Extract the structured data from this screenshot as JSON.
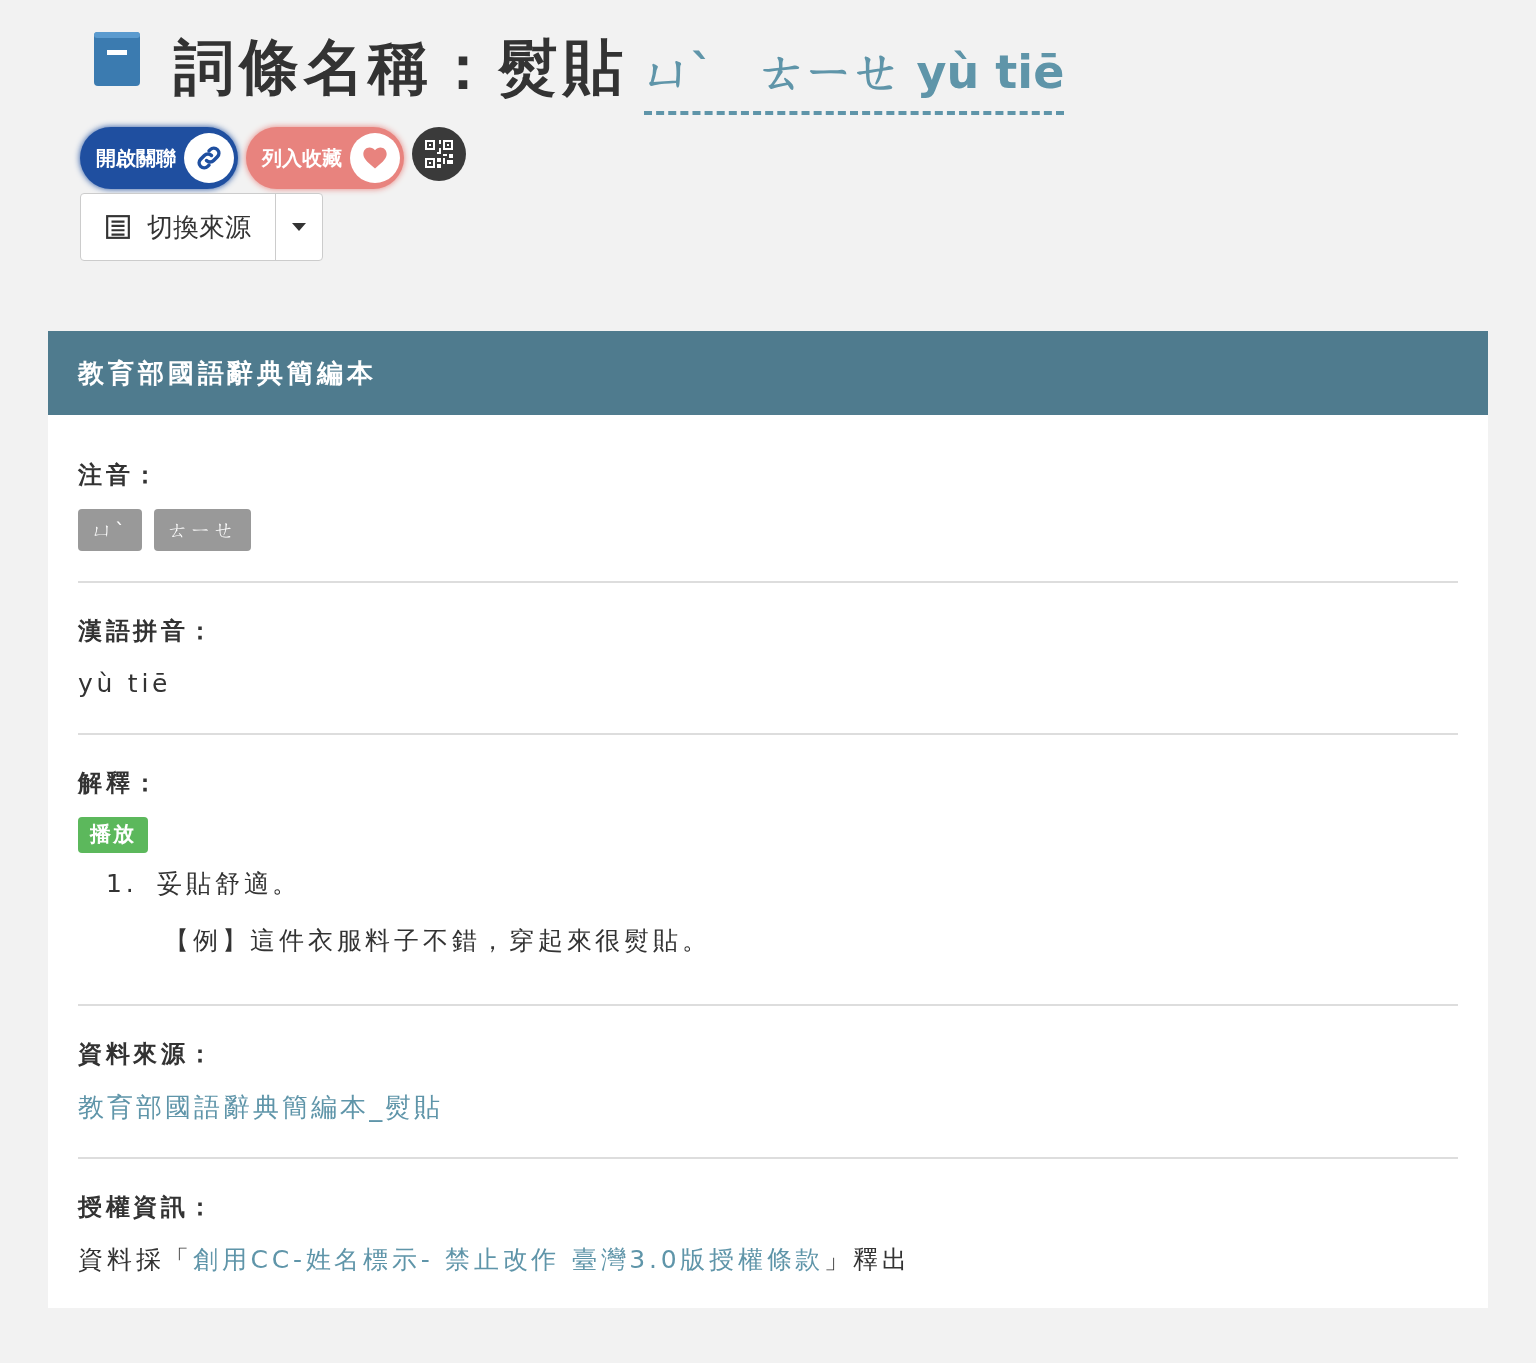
{
  "title": {
    "label": "詞條名稱：",
    "word": "熨貼",
    "pronunciation": "ㄩˋ　ㄊㄧㄝ yù tiē"
  },
  "actions": [
    {
      "kind": "link",
      "label": "開啟關聯"
    },
    {
      "kind": "favorite",
      "label": "列入收藏"
    },
    {
      "kind": "qrcode"
    }
  ],
  "source_switch": {
    "label": "切換來源"
  },
  "panel": {
    "title": "教育部國語辭典簡編本",
    "sections": [
      {
        "kind": "badges",
        "heading": "注音：",
        "items": [
          "ㄩˋ",
          "ㄊㄧㄝ"
        ]
      },
      {
        "kind": "text",
        "heading": "漢語拼音：",
        "text": "yù tiē"
      },
      {
        "kind": "definitions",
        "heading": "解釋：",
        "play_label": "播放",
        "items": [
          {
            "number": "1.",
            "text": "妥貼舒適。",
            "example": "【例】這件衣服料子不錯，穿起來很熨貼。"
          }
        ]
      },
      {
        "kind": "link",
        "heading": "資料來源：",
        "link": "教育部國語辭典簡編本_熨貼"
      },
      {
        "kind": "license",
        "heading": "授權資訊：",
        "before": "資料採「",
        "link": "創用CC-姓名標示- 禁止改作 臺灣3.0版授權條款",
        "after": "」釋出"
      }
    ]
  }
}
